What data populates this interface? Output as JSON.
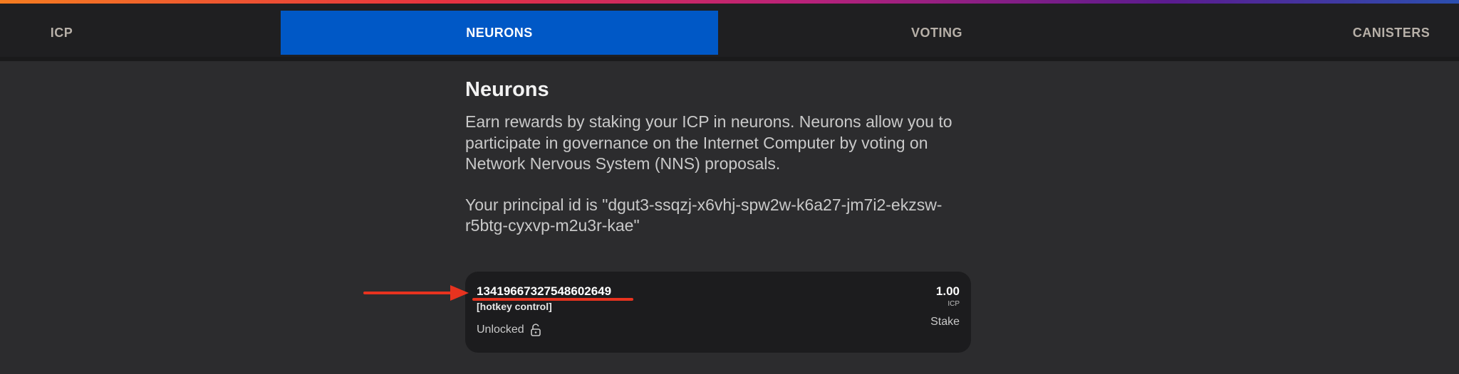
{
  "nav": {
    "tabs": [
      {
        "label": "ICP",
        "active": false
      },
      {
        "label": "NEURONS",
        "active": true
      },
      {
        "label": "VOTING",
        "active": false
      },
      {
        "label": "CANISTERS",
        "active": false
      }
    ]
  },
  "main": {
    "title": "Neurons",
    "description": "Earn rewards by staking your ICP in neurons. Neurons allow you to participate in governance on the Internet Computer by voting on Network Nervous System (NNS) proposals.",
    "principal_text": "Your principal id is \"dgut3-ssqzj-x6vhj-spw2w-k6a27-jm7i2-ekzsw-r5btg-cyxvp-m2u3r-kae\""
  },
  "neuron_card": {
    "id": "13419667327548602649",
    "tag": "[hotkey control]",
    "status": "Unlocked",
    "status_icon": "unlocked-padlock-icon",
    "amount": "1.00",
    "unit": "ICP",
    "amount_label": "Stake"
  },
  "colors": {
    "active_tab": "#0058c6",
    "background": "#2c2c2e",
    "card": "#1c1c1e",
    "annotation": "#e8331f"
  }
}
